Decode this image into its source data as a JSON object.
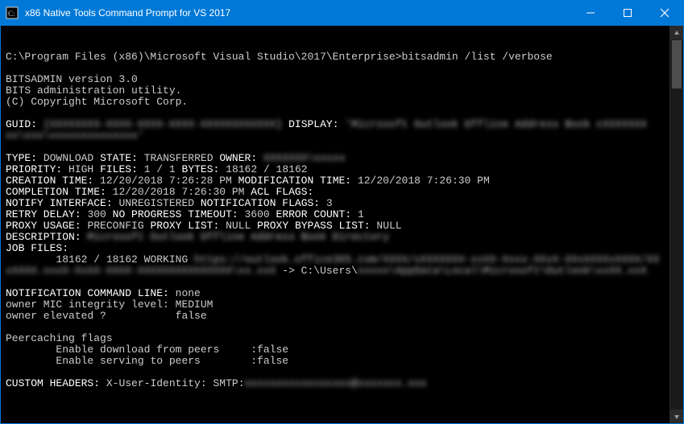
{
  "titlebar": {
    "title": "x86 Native Tools Command Prompt for VS 2017"
  },
  "prompt": {
    "cwd": "C:\\Program Files (x86)\\Microsoft Visual Studio\\2017\\Enterprise>",
    "command": "bitsadmin /list /verbose"
  },
  "banner": {
    "l1": "BITSADMIN version 3.0",
    "l2": "BITS administration utility.",
    "l3": "(C) Copyright Microsoft Corp."
  },
  "fields": {
    "guid_label": "GUID:",
    "guid_value": "{XXXXXXXX-XXXX-XXXX-XXXX-XXXXXXXXXXXX}",
    "display_label": "DISPLAY:",
    "display_value": "'Microsoft Outlook Offline Address Book cXXXXXXX",
    "display_value2": "xx\\xxx\\xxxxxxxxxxxxxx'",
    "type_label": "TYPE:",
    "type_value": "DOWNLOAD",
    "state_label": "STATE:",
    "state_value": "TRANSFERRED",
    "owner_label": "OWNER:",
    "owner_value": "XXXXXXX\\xxxxx",
    "priority_label": "PRIORITY:",
    "priority_value": "HIGH",
    "files_label": "FILES:",
    "files_value": "1 / 1",
    "bytes_label": "BYTES:",
    "bytes_value": "18162 / 18162",
    "creation_label": "CREATION TIME:",
    "creation_value": "12/20/2018 7:26:28 PM",
    "modification_label": "MODIFICATION TIME:",
    "modification_value": "12/20/2018 7:26:30 PM",
    "completion_label": "COMPLETION TIME:",
    "completion_value": "12/20/2018 7:26:30 PM",
    "acl_label": "ACL FLAGS:",
    "notify_if_label": "NOTIFY INTERFACE:",
    "notify_if_value": "UNREGISTERED",
    "notify_flags_label": "NOTIFICATION FLAGS:",
    "notify_flags_value": "3",
    "retry_label": "RETRY DELAY:",
    "retry_value": "300",
    "noprog_label": "NO PROGRESS TIMEOUT:",
    "noprog_value": "3600",
    "errcount_label": "ERROR COUNT:",
    "errcount_value": "1",
    "proxy_usage_label": "PROXY USAGE:",
    "proxy_usage_value": "PRECONFIG",
    "proxy_list_label": "PROXY LIST:",
    "proxy_list_value": "NULL",
    "proxy_bypass_label": "PROXY BYPASS LIST:",
    "proxy_bypass_value": "NULL",
    "description_label": "DESCRIPTION:",
    "description_value": "Microsoft Outlook Offline Address Book Directory",
    "jobfiles_label": "JOB FILES:",
    "jobfile_progress": "18162 / 18162",
    "jobfile_state": "WORKING",
    "jobfile_url": "https://outlook.office365.com/XXXX/xXXXXXXX-xxXX-Xxxx-XXxX-XXxXXXXxXXXX/XX",
    "jobfile_url2": "xXXXX.xxxX-XxXX-XXXX-XXXXXXXXXXXXXXX\\xx.xxX",
    "jobfile_arrow": " -> C:\\Users\\",
    "jobfile_local": "xxxxx\\AppData\\Local\\Microsoft\\Outlook\\xxXX.xxX",
    "notify_cmd_label": "NOTIFICATION COMMAND LINE:",
    "notify_cmd_value": "none",
    "mic_label": "owner MIC integrity level:",
    "mic_value": "MEDIUM",
    "elevated_label": "owner elevated ?",
    "elevated_value": "false",
    "peercache_label": "Peercaching flags",
    "peer_dl_label": "Enable download from peers",
    "peer_dl_value": ":false",
    "peer_srv_label": "Enable serving to peers",
    "peer_srv_value": ":false",
    "custom_headers_label": "CUSTOM HEADERS:",
    "custom_headers_key": "X-User-Identity:",
    "custom_headers_proto": "SMTP:",
    "custom_headers_value": "xxxxxxxxxxxxxxxxx@xxxxxxx.xxx"
  }
}
